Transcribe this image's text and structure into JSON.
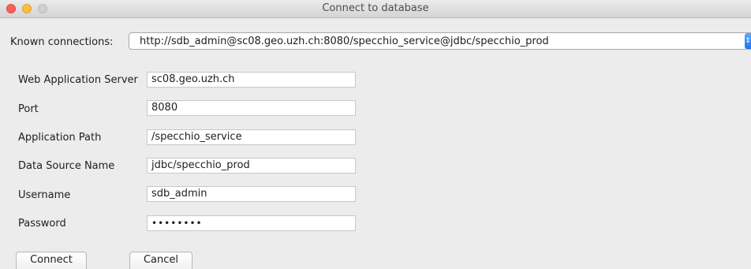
{
  "window": {
    "title": "Connect to database"
  },
  "known_connections": {
    "label": "Known connections:",
    "selected": "http://sdb_admin@sc08.geo.uzh.ch:8080/specchio_service@jdbc/specchio_prod"
  },
  "form": {
    "server_label": "Web Application Server",
    "server_value": "sc08.geo.uzh.ch",
    "port_label": "Port",
    "port_value": "8080",
    "path_label": "Application Path",
    "path_value": "/specchio_service",
    "datasource_label": "Data Source Name",
    "datasource_value": "jdbc/specchio_prod",
    "username_label": "Username",
    "username_value": "sdb_admin",
    "password_label": "Password",
    "password_value": "••••••••"
  },
  "buttons": {
    "connect": "Connect",
    "cancel": "Cancel"
  },
  "icons": {
    "select_arrows": "updown-arrows-icon"
  },
  "colors": {
    "close": "#fc605c",
    "minimize": "#fdbc40",
    "select_accent": "#1877f0"
  }
}
